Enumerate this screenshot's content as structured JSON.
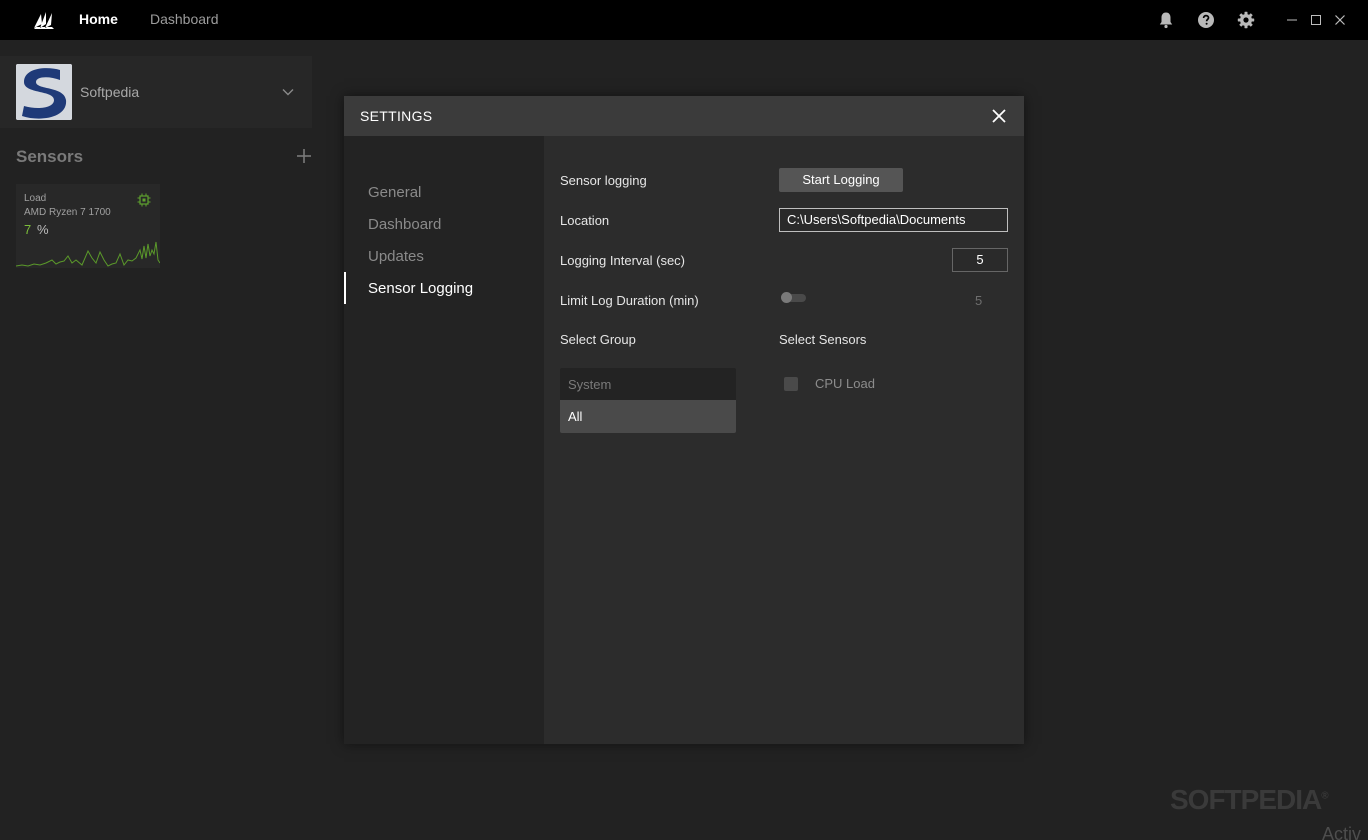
{
  "topbar": {
    "nav_home": "Home",
    "nav_dashboard": "Dashboard",
    "icons": [
      "notification-bell-icon",
      "help-icon",
      "settings-gear-icon",
      "minimize-icon",
      "maximize-icon",
      "close-icon"
    ]
  },
  "sidebar": {
    "profile_name": "Softpedia",
    "sensors_title": "Sensors",
    "card": {
      "label": "Load",
      "device": "AMD Ryzen 7 1700",
      "value": "7",
      "unit": "%",
      "spark_color": "#5b9a2a"
    }
  },
  "dialog": {
    "title": "SETTINGS",
    "nav": [
      "General",
      "Dashboard",
      "Updates",
      "Sensor Logging"
    ],
    "active_nav": "Sensor Logging",
    "content": {
      "sensor_logging_label": "Sensor logging",
      "start_button": "Start Logging",
      "location_label": "Location",
      "location_value": "C:\\Users\\Softpedia\\Documents",
      "interval_label": "Logging Interval (sec)",
      "interval_value": "5",
      "limit_label": "Limit Log Duration (min)",
      "limit_value": "5",
      "limit_enabled": false,
      "select_group_label": "Select Group",
      "select_sensors_label": "Select Sensors",
      "group_placeholder": "System",
      "group_selected": "All",
      "sensor_option": "CPU Load",
      "sensor_checked": false
    }
  },
  "watermark": "SOFTPEDIA",
  "watermark_mark": "®",
  "activate_text": "Activ"
}
